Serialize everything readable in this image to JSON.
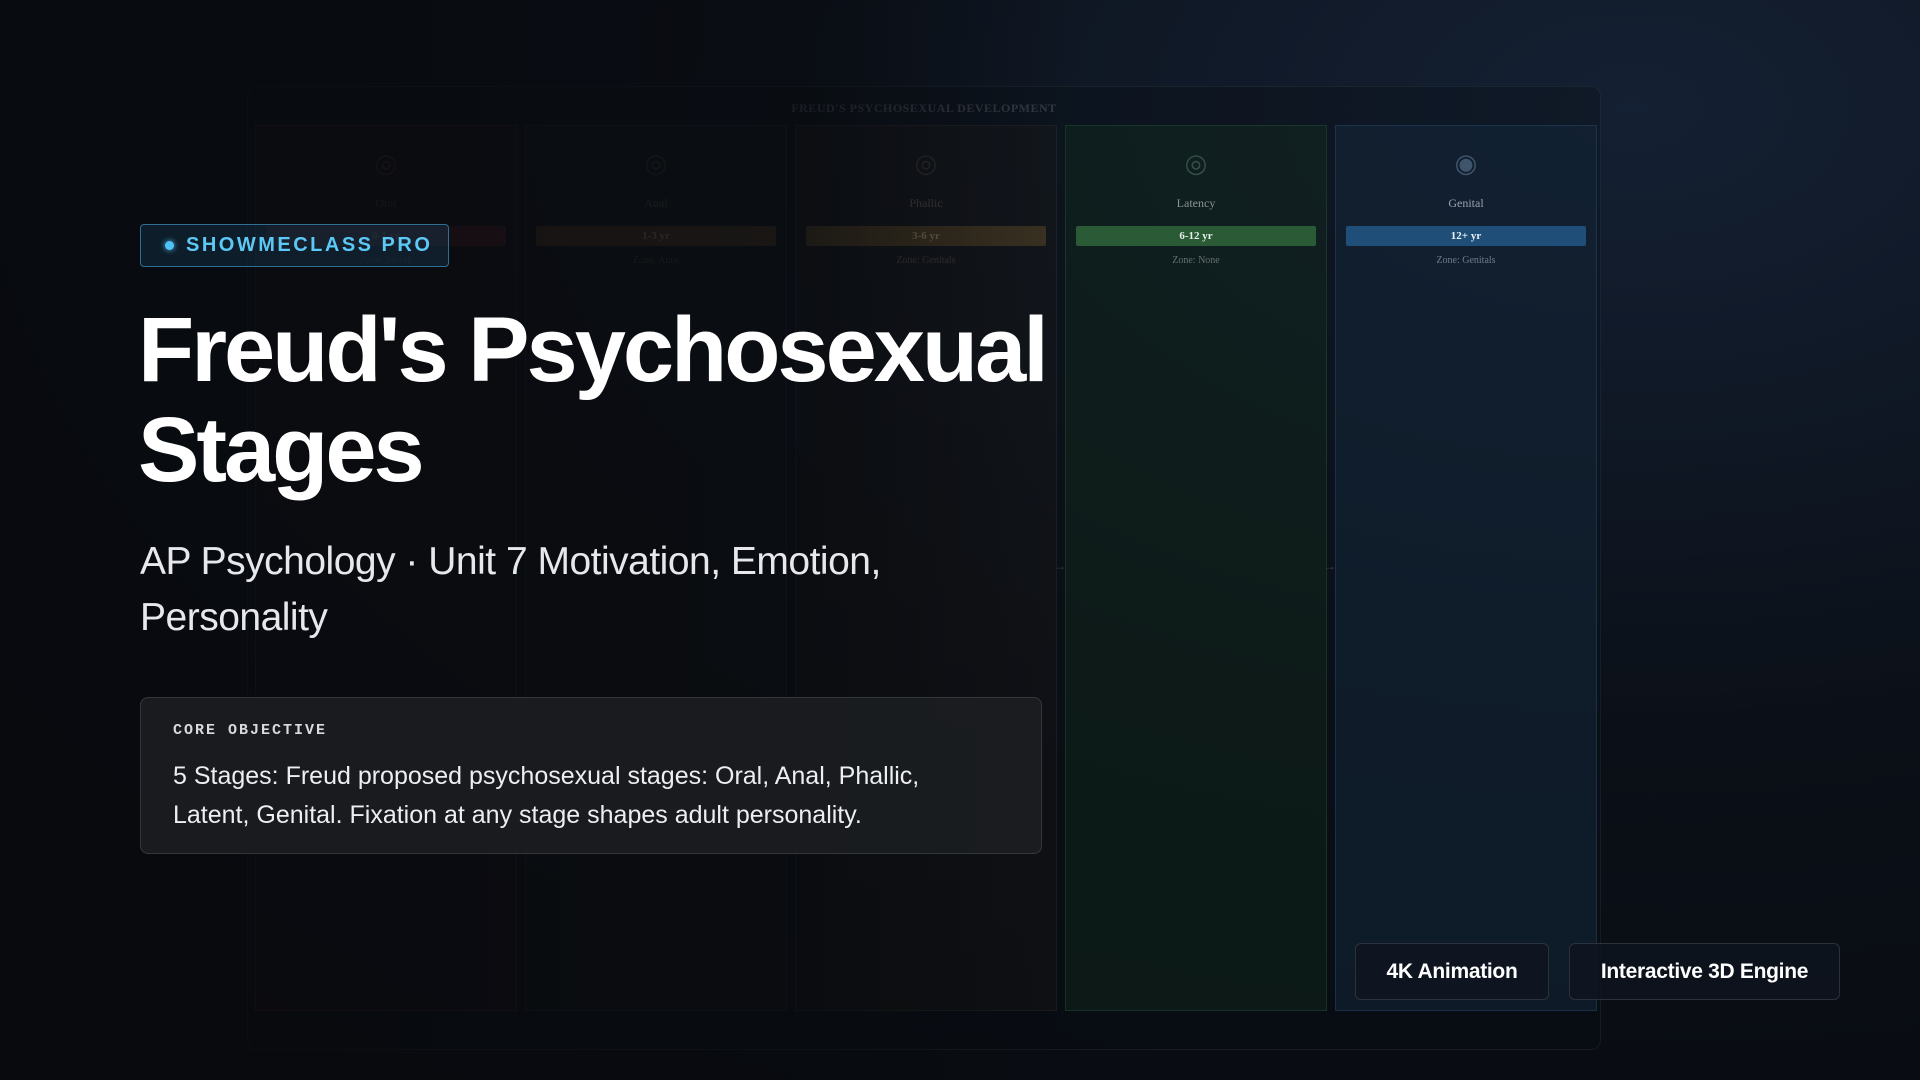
{
  "diagram": {
    "title": "FREUD'S PSYCHOSEXUAL DEVELOPMENT",
    "stages": [
      {
        "name": "Oral",
        "age": "0-1 yr",
        "zone": "Zone: Mouth",
        "icon": "baby-icon",
        "color": "#8b2e2e"
      },
      {
        "name": "Anal",
        "age": "1-3 yr",
        "zone": "Zone: Anus",
        "icon": "toddler-icon",
        "color": "#8b5a2e"
      },
      {
        "name": "Phallic",
        "age": "3-6 yr",
        "zone": "Zone: Genitals",
        "icon": "child-icon",
        "color": "#8b6a2e"
      },
      {
        "name": "Latency",
        "age": "6-12 yr",
        "zone": "Zone: None",
        "icon": "student-icon",
        "color": "#2e6b3c"
      },
      {
        "name": "Genital",
        "age": "12+ yr",
        "zone": "Zone: Genitals",
        "icon": "adult-icon",
        "color": "#1f4e78"
      }
    ]
  },
  "badge": {
    "label": "SHOWMECLASS PRO",
    "color": "#5cc8f5"
  },
  "title": "Freud's Psychosexual Stages",
  "subtitle": "AP Psychology · Unit 7 Motivation, Emotion, Personality",
  "objective": {
    "label": "CORE OBJECTIVE",
    "text": "5 Stages: Freud proposed psychosexual stages: Oral, Anal, Phallic, Latent, Genital. Fixation at any stage shapes adult personality."
  },
  "features": [
    "4K Animation",
    "Interactive 3D Engine"
  ]
}
